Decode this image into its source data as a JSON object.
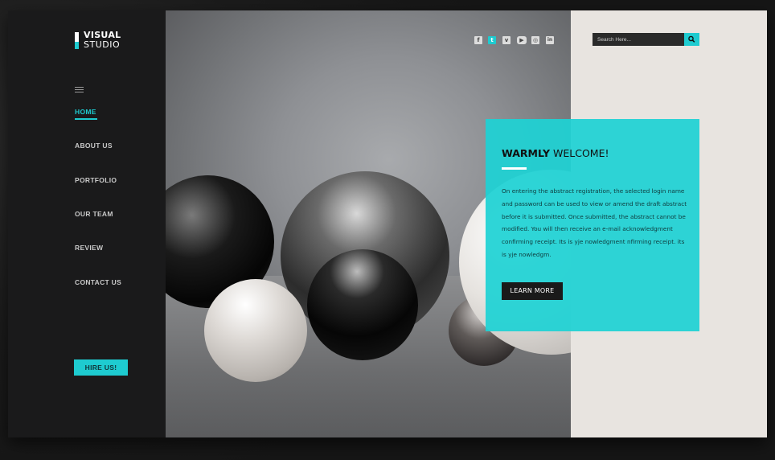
{
  "brand": {
    "line1": "VISUAL",
    "line2": "STUDIO",
    "accent_color": "#1ecbd0"
  },
  "nav": {
    "menu_icon": "hamburger-menu-icon",
    "items": [
      {
        "label": "HOME",
        "active": true
      },
      {
        "label": "ABOUT US",
        "active": false
      },
      {
        "label": "PORTFOLIO",
        "active": false
      },
      {
        "label": "OUR TEAM",
        "active": false
      },
      {
        "label": "REVIEW",
        "active": false
      },
      {
        "label": "CONTACT US",
        "active": false
      }
    ],
    "cta_label": "HIRE US!"
  },
  "social": [
    {
      "icon": "facebook-icon",
      "glyph": "f"
    },
    {
      "icon": "twitter-icon",
      "glyph": "t"
    },
    {
      "icon": "vimeo-icon",
      "glyph": "v"
    },
    {
      "icon": "youtube-icon",
      "glyph": "▶"
    },
    {
      "icon": "instagram-icon",
      "glyph": "◎"
    },
    {
      "icon": "linkedin-icon",
      "glyph": "in"
    }
  ],
  "search": {
    "placeholder": "Search Here...",
    "button_icon": "search-icon"
  },
  "welcome": {
    "title_bold": "WARMLY",
    "title_rest": " WELCOME!",
    "body": "On entering the abstract registration, the selected login name and password can be used to view or amend the draft abstract before it is submitted. Once submitted, the abstract cannot be modified. You will then receive an e-mail acknowledgment confirming receipt.  Its is yje nowledgment nfirming receipt. its is yje nowledgm.",
    "button_label": "LEARN MORE"
  }
}
